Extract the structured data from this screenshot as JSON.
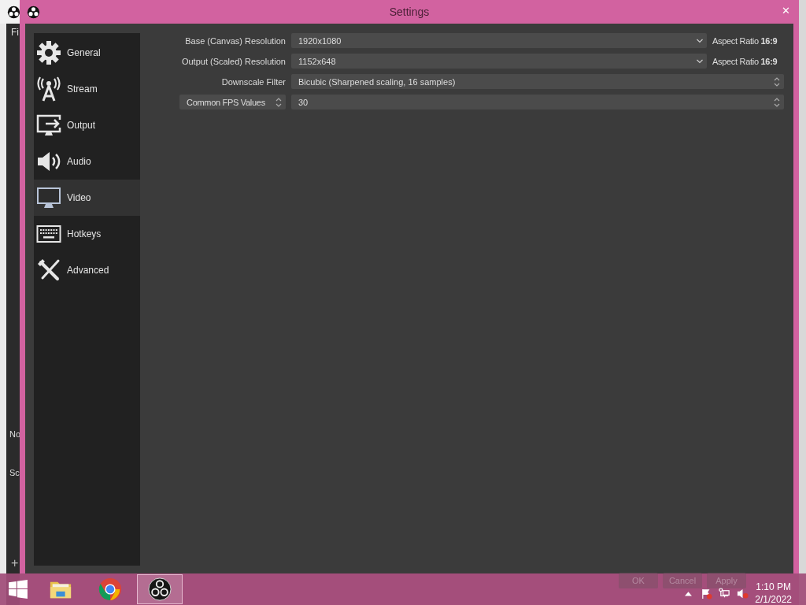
{
  "background_window": {
    "menu_text": "Fi",
    "labels": [
      "No",
      "Sc"
    ],
    "add_button": "+"
  },
  "window": {
    "title": "Settings",
    "close": "✕"
  },
  "sidebar": {
    "items": [
      {
        "label": "General",
        "kind": "gear",
        "selected": false
      },
      {
        "label": "Stream",
        "kind": "antenna",
        "selected": false
      },
      {
        "label": "Output",
        "kind": "output",
        "selected": false
      },
      {
        "label": "Audio",
        "kind": "speaker",
        "selected": false
      },
      {
        "label": "Video",
        "kind": "monitor",
        "selected": true
      },
      {
        "label": "Hotkeys",
        "kind": "keyboard",
        "selected": false
      },
      {
        "label": "Advanced",
        "kind": "tools",
        "selected": false
      }
    ]
  },
  "video": {
    "rows": [
      {
        "kind": "combo",
        "label": "Base (Canvas) Resolution",
        "value": "1920x1080",
        "aspect": "Aspect Ratio **16:9**"
      },
      {
        "kind": "combo",
        "label": "Output (Scaled) Resolution",
        "value": "1152x648",
        "aspect": "Aspect Ratio **16:9**"
      },
      {
        "kind": "spin",
        "label": "Downscale Filter",
        "value": "Bicubic (Sharpened scaling, 16 samples)"
      },
      {
        "kind": "fps",
        "label": "Common FPS Values",
        "value": "30"
      }
    ]
  },
  "buttons": [
    "OK",
    "Cancel",
    "Apply"
  ],
  "taskbar": {
    "apps": [
      {
        "kind": "explorer",
        "selected": false
      },
      {
        "kind": "chrome",
        "selected": false
      },
      {
        "kind": "obs",
        "selected": true
      }
    ],
    "time": "1:10 PM",
    "date": "2/1/2022"
  }
}
